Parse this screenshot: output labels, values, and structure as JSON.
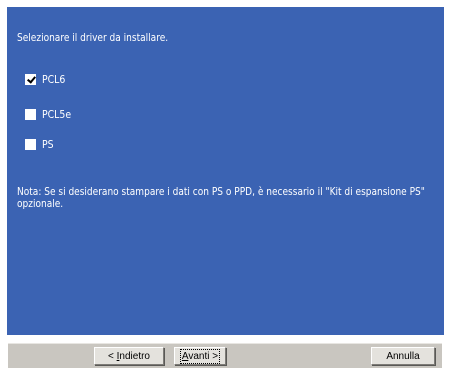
{
  "dialog": {
    "instruction": "Selezionare il driver da installare.",
    "options": [
      {
        "label": "PCL6",
        "checked": true
      },
      {
        "label": "PCL5e",
        "checked": false
      },
      {
        "label": "PS",
        "checked": false
      }
    ],
    "note": "Nota: Se si desiderano stampare i dati con PS o PPD, è necessario il \"Kit di espansione PS\" opzionale."
  },
  "buttons": {
    "back": {
      "prefix": "< ",
      "mnemonic": "I",
      "rest": "ndietro"
    },
    "next": {
      "mnemonic": "A",
      "rest": "vanti",
      "suffix": " >"
    },
    "cancel": "Annulla"
  },
  "colors": {
    "panel_bg": "#3b63b3",
    "button_bar": "#c9c6c0"
  }
}
